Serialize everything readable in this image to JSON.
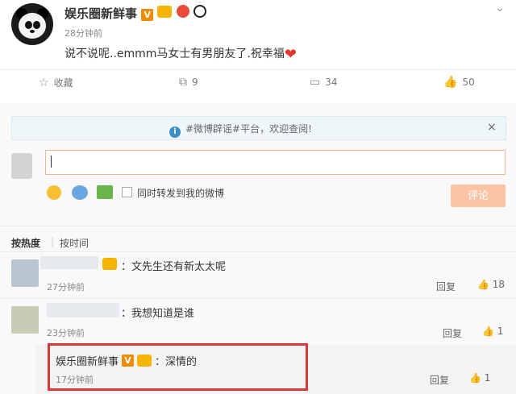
{
  "post": {
    "author": "娱乐圈新鲜事",
    "verified_badge": "V",
    "time": "28分钟前",
    "text": "说不说呢..emmm马女士有男朋友了.祝幸福",
    "heart_icon": "heart-icon"
  },
  "actions": {
    "favorite": "收藏",
    "repost_count": "9",
    "comment_count": "34",
    "like_count": "50"
  },
  "notice": {
    "text": "#微博辟谣#平台，欢迎查阅!",
    "close": "×"
  },
  "composer": {
    "repost_label": "同时转发到我的微博",
    "submit_label": "评论"
  },
  "sort": {
    "hot": "按热度",
    "time": "按时间"
  },
  "comments": [
    {
      "text": "：文先生还有新太太呢",
      "time": "27分钟前",
      "reply": "回复",
      "likes": "18"
    },
    {
      "text": "：我想知道是谁",
      "time": "23分钟前",
      "reply": "回复",
      "likes": "1"
    }
  ],
  "sub_reply": {
    "author": "娱乐圈新鲜事",
    "badge": "V",
    "text": "：深情的",
    "time": "17分钟前",
    "reply": "回复",
    "likes": "1"
  },
  "colors": {
    "accent_orange": "#f08a00",
    "highlight_red": "#d9373a",
    "submit_bg": "#fbc3a5"
  }
}
